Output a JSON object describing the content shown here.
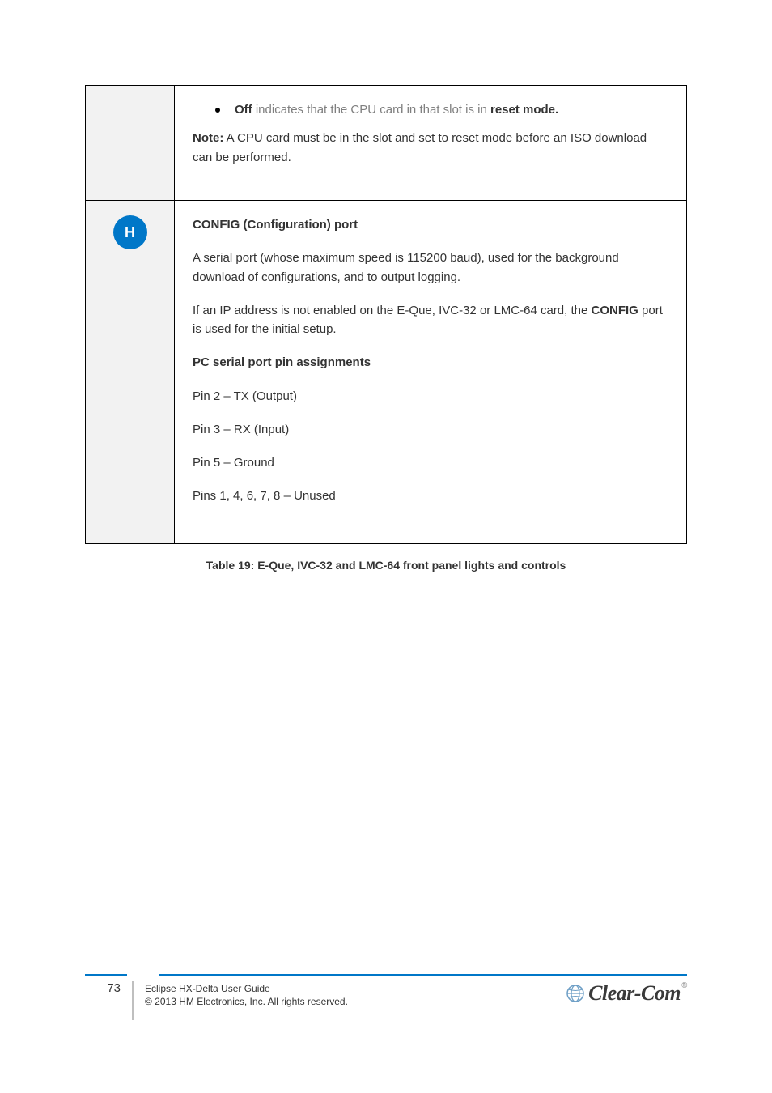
{
  "row1": {
    "bullet_bold": "Off",
    "bullet_gray": " indicates that the CPU card in that slot is in ",
    "bullet_bold2": "reset mode.",
    "note_bold": "Note:",
    "note_text": " A CPU card must be in the slot and set to reset mode before an ISO download can be performed. "
  },
  "marker": "H",
  "row2": {
    "heading": "CONFIG (Configuration) port",
    "p1": "A serial port (whose maximum speed is 115200 baud), used for the background download of configurations, and to output logging.",
    "p2_pre": "If an IP address is not enabled on the E-Que, IVC-32 or LMC-64 card, the ",
    "p2_bold": "CONFIG",
    "p2_post": " port is used for the initial setup. ",
    "subheading": "PC serial port pin assignments",
    "pin1": "Pin 2 – TX (Output)",
    "pin2": "Pin 3 – RX (Input)",
    "pin3": "Pin 5 – Ground",
    "pins_other": "Pins 1, 4, 6, 7, 8 – Unused"
  },
  "caption": "Table 19: E-Que, IVC-32 and LMC-64 front panel lights and controls",
  "footer": {
    "page": "73",
    "line1": "Eclipse HX-Delta User Guide  ",
    "line2": "© 2013 HM Electronics, Inc. All rights reserved.",
    "logo_brand": "Clear-Com"
  }
}
